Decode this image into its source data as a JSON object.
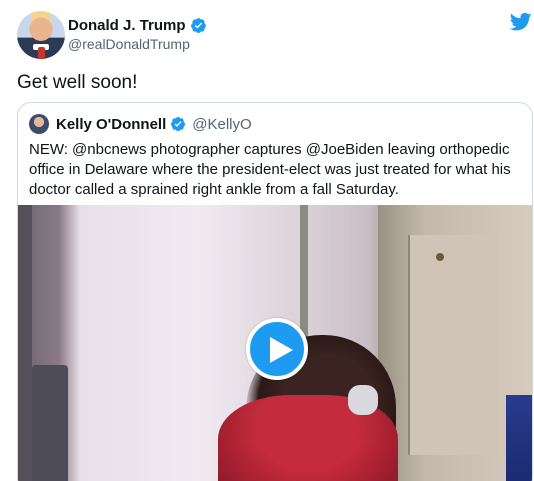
{
  "tweet": {
    "display_name": "Donald J. Trump",
    "handle": "@realDonaldTrump",
    "text": "Get well soon!"
  },
  "quote": {
    "display_name": "Kelly O'Donnell",
    "handle": "@KellyO",
    "text": "NEW:  @nbcnews photographer captures @JoeBiden leaving orthopedic office in Delaware where the president-elect was just treated for what his doctor called a sprained right ankle from a fall Saturday."
  },
  "icons": {
    "verified": "verified-badge-icon",
    "brand": "twitter-bird-icon",
    "play": "play-icon"
  },
  "colors": {
    "accent": "#1d9bf0",
    "text": "#0f1419",
    "muted": "#536471",
    "border": "#cfd9de"
  }
}
